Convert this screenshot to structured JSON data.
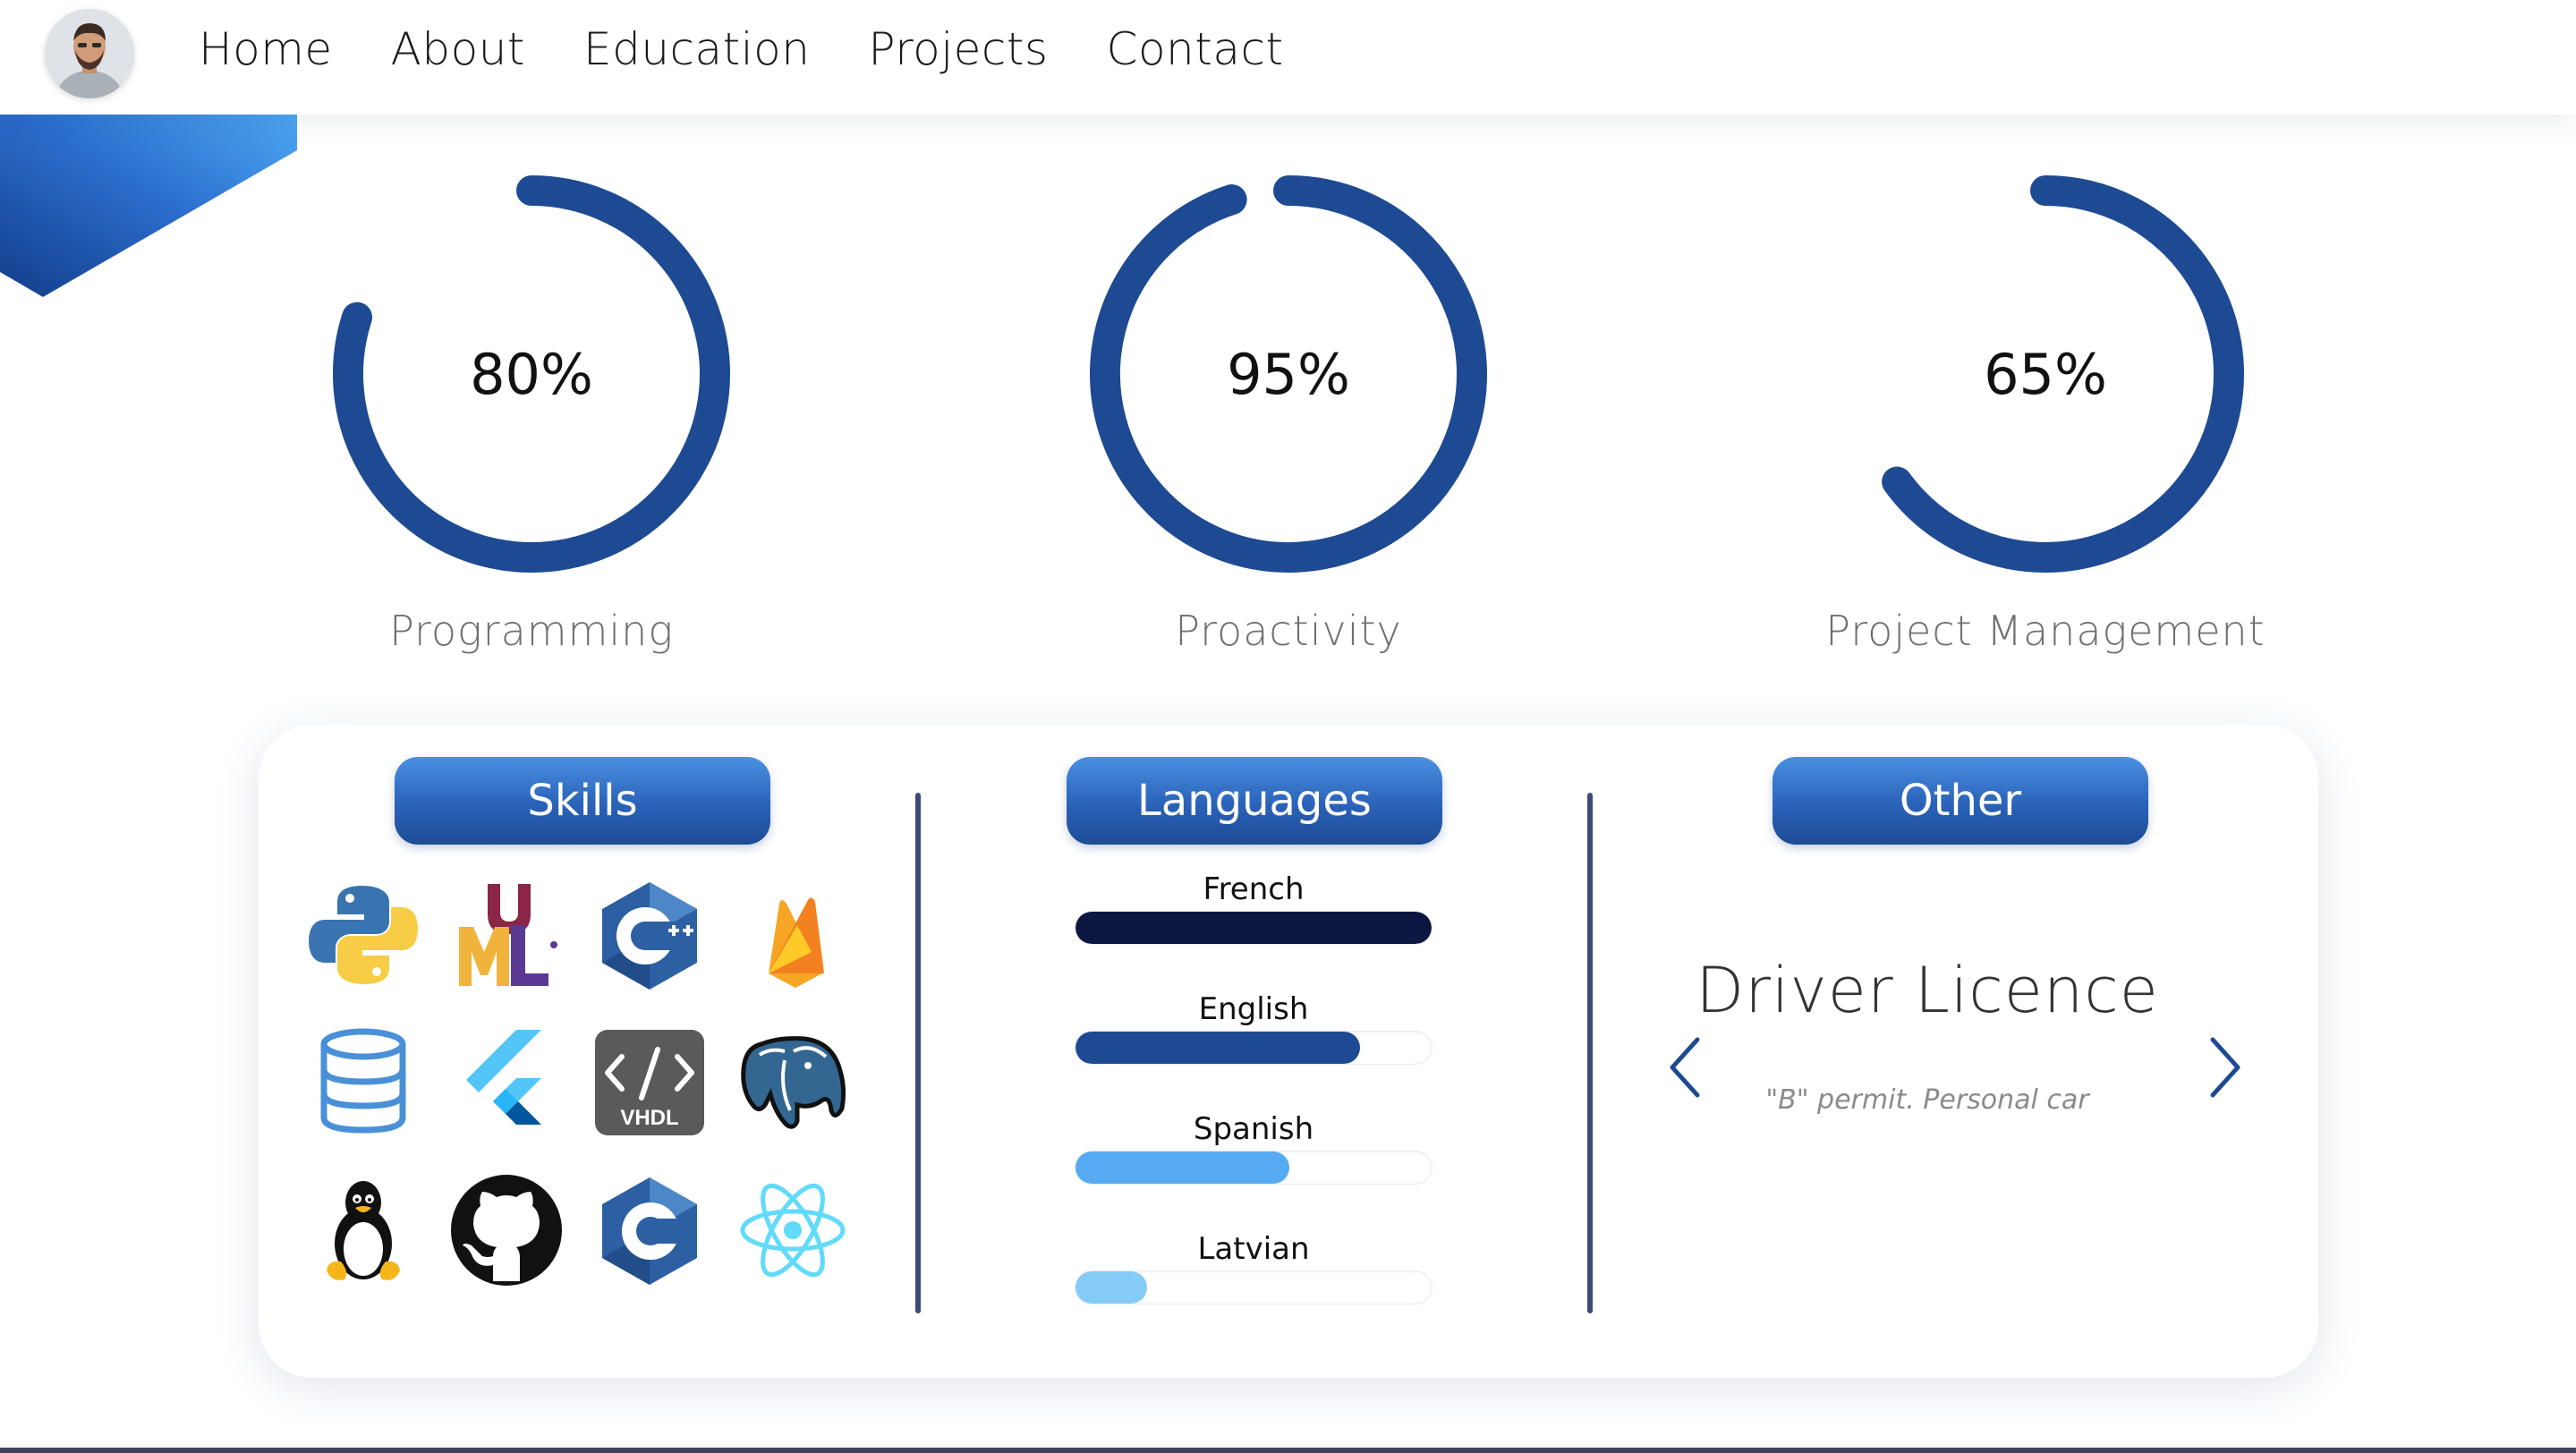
{
  "nav": {
    "links": [
      "Home",
      "About",
      "Education",
      "Projects",
      "Contact"
    ]
  },
  "gauges": [
    {
      "value_text": "80%",
      "percent": 80,
      "label": "Programming"
    },
    {
      "value_text": "95%",
      "percent": 95,
      "label": "Proactivity"
    },
    {
      "value_text": "65%",
      "percent": 65,
      "label": "Project Management"
    }
  ],
  "sections": {
    "skills": "Skills",
    "languages": "Languages",
    "other": "Other"
  },
  "skills_icons": [
    "python-icon",
    "uml-icon",
    "cpp-icon",
    "firebase-icon",
    "database-icon",
    "flutter-icon",
    "vhdl-icon",
    "postgresql-icon",
    "linux-icon",
    "github-icon",
    "c-icon",
    "react-icon"
  ],
  "vhdl_text": "VHDL",
  "languages": [
    {
      "name": "French",
      "level": 100,
      "color": "#0b1740"
    },
    {
      "name": "English",
      "level": 80,
      "color": "#1d4a92"
    },
    {
      "name": "Spanish",
      "level": 60,
      "color": "#56aaf2"
    },
    {
      "name": "Latvian",
      "level": 20,
      "color": "#85cbf8"
    }
  ],
  "other": {
    "title": "Driver Licence",
    "subtitle": "\"B\" permit. Personal car"
  },
  "colors": {
    "gauge": "#1d4a92",
    "accent": "#2a62b8",
    "divider": "#3e4a78"
  }
}
